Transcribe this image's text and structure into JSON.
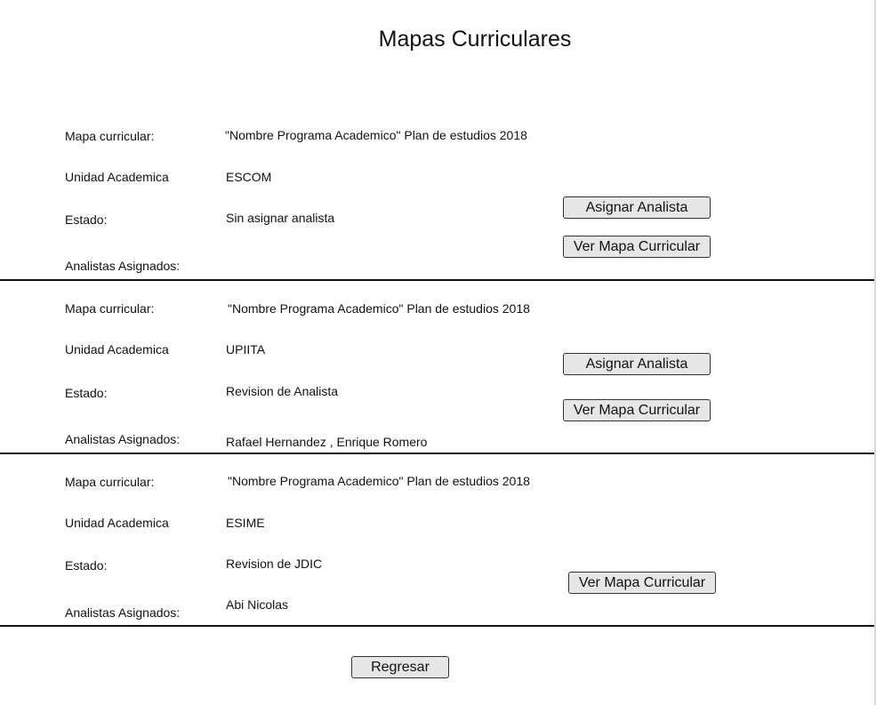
{
  "page": {
    "title": "Mapas Curriculares"
  },
  "labels": {
    "mapa": "Mapa curricular:",
    "unidad": "Unidad Academica",
    "estado": "Estado:",
    "analistas": "Analistas Asignados:"
  },
  "records": [
    {
      "mapa": "\"Nombre Programa Academico\" Plan de estudios 2018",
      "unidad": "ESCOM",
      "estado": "Sin asignar analista",
      "analistas": "",
      "assign_label": "Asignar Analista",
      "view_label": "Ver Mapa Curricular"
    },
    {
      "mapa": "\"Nombre Programa Academico\"   Plan de estudios 2018",
      "unidad": "UPIITA",
      "estado": "Revision de Analista",
      "analistas": "Rafael Hernandez , Enrique Romero",
      "assign_label": "Asignar Analista",
      "view_label": "Ver Mapa Curricular"
    },
    {
      "mapa": "\"Nombre Programa Academico\"   Plan de estudios 2018",
      "unidad": "ESIME",
      "estado": "Revision de JDIC",
      "analistas": "Abi Nicolas",
      "view_label": "Ver Mapa Curricular"
    }
  ],
  "footer": {
    "back_label": "Regresar"
  }
}
